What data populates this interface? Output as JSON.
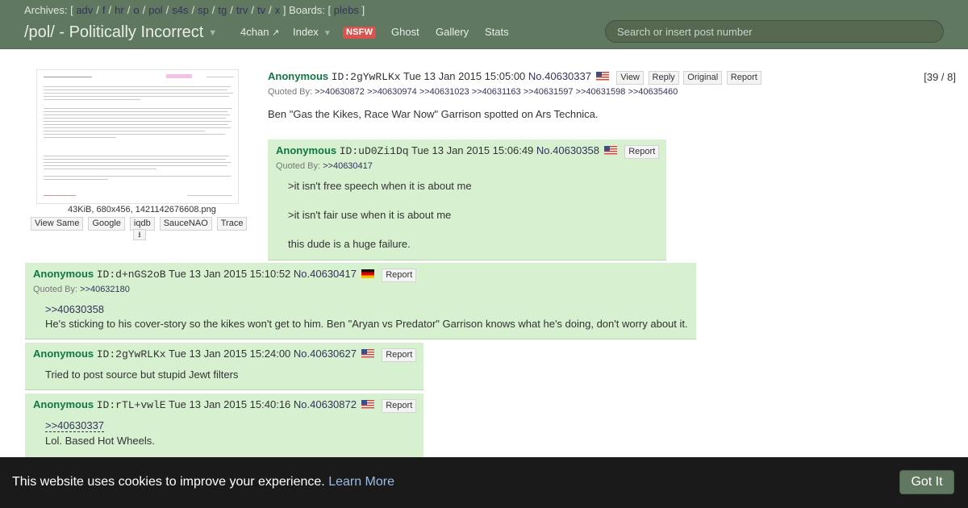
{
  "header": {
    "archives_label": "Archives:",
    "archives": [
      "adv",
      "f",
      "hr",
      "o",
      "pol",
      "s4s",
      "sp",
      "tg",
      "trv",
      "tv",
      "x"
    ],
    "boards_label": "Boards:",
    "boards": [
      "plebs"
    ],
    "board_title": "/pol/ - Politically Incorrect",
    "nav": {
      "fourchan": "4chan",
      "index": "Index",
      "nsfw": "NSFW",
      "ghost": "Ghost",
      "gallery": "Gallery",
      "stats": "Stats"
    },
    "search_placeholder": "Search or insert post number",
    "colors": {
      "header_bg": "#60785f",
      "nsfw_bg": "#d9534f"
    }
  },
  "op": {
    "name": "Anonymous",
    "id": "ID:2gYwRLKx",
    "date": "Tue 13 Jan 2015 15:05:00",
    "no": "No.40630337",
    "flag": "us-flag",
    "actions": [
      "View",
      "Reply",
      "Original",
      "Report"
    ],
    "counter": "[39 / 8]",
    "quoted_label": "Quoted By:",
    "quoted_by": [
      ">>40630872",
      ">>40630974",
      ">>40631023",
      ">>40631163",
      ">>40631597",
      ">>40631598",
      ">>40635460"
    ],
    "body": "Ben \"Gas the Kikes, Race War Now\" Garrison spotted on Ars Technica.",
    "file_info": "43KiB, 680x456, 1421142676608.png",
    "image_buttons": [
      "View Same",
      "Google",
      "iqdb",
      "SauceNAO",
      "Trace"
    ],
    "download_icon": "download-icon"
  },
  "replies": [
    {
      "name": "Anonymous",
      "id": "ID:uD0Zi1Dq",
      "date": "Tue 13 Jan 2015 15:06:49",
      "no": "No.40630358",
      "flag": "us-flag",
      "report": "Report",
      "quoted_label": "Quoted By:",
      "quoted_by": [
        ">>40630417"
      ],
      "lines": [
        ">it isn't free speech when it is about me",
        ">it isn't fair use when it is about me",
        "this dude is a huge failure."
      ]
    },
    {
      "name": "Anonymous",
      "id": "ID:d+nGS2oB",
      "date": "Tue 13 Jan 2015 15:10:52",
      "no": "No.40630417",
      "flag": "de-flag",
      "report": "Report",
      "quoted_label": "Quoted By:",
      "quoted_by": [
        ">>40632180"
      ],
      "lines": [
        ">>40630358",
        "He's sticking to his cover-story so the kikes won't get to him. Ben \"Aryan vs Predator\" Garrison knows what he's doing, don't worry about it."
      ]
    },
    {
      "name": "Anonymous",
      "id": "ID:2gYwRLKx",
      "date": "Tue 13 Jan 2015 15:24:00",
      "no": "No.40630627",
      "flag": "us-flag",
      "report": "Report",
      "lines": [
        "Tried to post source but stupid Jewt filters"
      ]
    },
    {
      "name": "Anonymous",
      "id": "ID:rTL+vwlE",
      "date": "Tue 13 Jan 2015 15:40:16",
      "no": "No.40630872",
      "flag": "us-flag",
      "report": "Report",
      "lines": [
        ">>40630337",
        "Lol. Based Hot Wheels."
      ]
    }
  ],
  "cookie": {
    "message": "This website uses cookies to improve your experience.",
    "learn_more": "Learn More",
    "button": "Got It"
  }
}
